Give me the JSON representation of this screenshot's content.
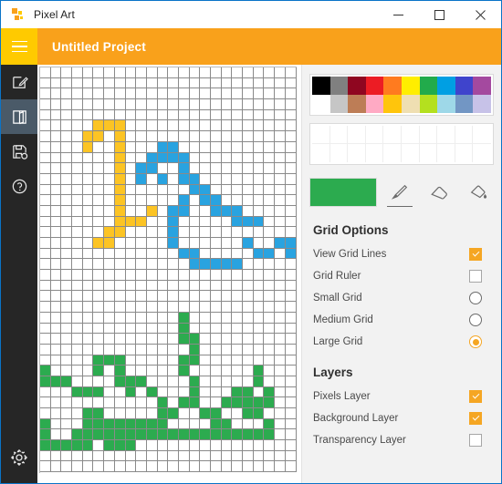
{
  "window": {
    "title": "Pixel Art",
    "app_icon": "pixel-art-icon",
    "minimize_label": "—",
    "maximize_label": "□",
    "close_label": "✕"
  },
  "header": {
    "menu_icon": "hamburger-menu-icon",
    "project_title": "Untitled Project",
    "accent_color": "#f9a11b",
    "menu_bg_color": "#ffca00"
  },
  "rail": {
    "items": [
      {
        "name": "new-document",
        "icon": "pencil-square-icon",
        "active": false
      },
      {
        "name": "open-document",
        "icon": "open-folder-icon",
        "active": true
      },
      {
        "name": "save-document",
        "icon": "save-as-icon",
        "active": false
      },
      {
        "name": "help",
        "icon": "question-circle-icon",
        "active": false
      }
    ],
    "settings": {
      "name": "settings",
      "icon": "gear-icon"
    },
    "background_color": "#262626",
    "active_color": "#4a5a68"
  },
  "palette": {
    "row1": [
      "#000000",
      "#808080",
      "#8f0620",
      "#ec1c24",
      "#ff7b1f",
      "#ffee00",
      "#22ab4b",
      "#009fe3",
      "#3f44cc",
      "#a4499f"
    ],
    "row2": [
      "#ffffff",
      "#c6c6c6",
      "#bd7d56",
      "#ffaac4",
      "#ffc50c",
      "#efdfb2",
      "#b4e01f",
      "#9ed8e8",
      "#7296c4",
      "#c7c2e8"
    ],
    "empty_rows": 2,
    "empty_cols": 10
  },
  "tools": {
    "current_color": "#2cab4f",
    "items": [
      {
        "name": "pencil-tool",
        "icon": "pencil-icon",
        "active": true
      },
      {
        "name": "eraser-tool",
        "icon": "eraser-icon",
        "active": false
      },
      {
        "name": "fill-tool",
        "icon": "paint-bucket-icon",
        "active": false
      }
    ]
  },
  "grid_options": {
    "title": "Grid Options",
    "checks": [
      {
        "label": "View Grid Lines",
        "checked": true,
        "name": "view-grid-lines"
      },
      {
        "label": "Grid Ruler",
        "checked": false,
        "name": "grid-ruler"
      }
    ],
    "radios": [
      {
        "label": "Small Grid",
        "selected": false,
        "name": "small-grid"
      },
      {
        "label": "Medium Grid",
        "selected": false,
        "name": "medium-grid"
      },
      {
        "label": "Large Grid",
        "selected": true,
        "name": "large-grid"
      }
    ]
  },
  "layers": {
    "title": "Layers",
    "items": [
      {
        "label": "Pixels Layer",
        "checked": true,
        "name": "pixels-layer"
      },
      {
        "label": "Background Layer",
        "checked": true,
        "name": "background-layer"
      },
      {
        "label": "Transparency Layer",
        "checked": false,
        "name": "transparency-layer"
      }
    ]
  },
  "canvas": {
    "cols": 24,
    "rows": 38,
    "cell_size": 11.7,
    "colors": {
      "y": "#fcc424",
      "b": "#29a3e0",
      "g": "#2cab4f"
    },
    "pixels": [
      {
        "r": 5,
        "c": 5,
        "k": "y"
      },
      {
        "r": 5,
        "c": 6,
        "k": "y"
      },
      {
        "r": 5,
        "c": 7,
        "k": "y"
      },
      {
        "r": 6,
        "c": 4,
        "k": "y"
      },
      {
        "r": 6,
        "c": 5,
        "k": "y"
      },
      {
        "r": 6,
        "c": 7,
        "k": "y"
      },
      {
        "r": 7,
        "c": 4,
        "k": "y"
      },
      {
        "r": 7,
        "c": 7,
        "k": "y"
      },
      {
        "r": 8,
        "c": 7,
        "k": "y"
      },
      {
        "r": 9,
        "c": 7,
        "k": "y"
      },
      {
        "r": 10,
        "c": 7,
        "k": "y"
      },
      {
        "r": 11,
        "c": 7,
        "k": "y"
      },
      {
        "r": 12,
        "c": 7,
        "k": "y"
      },
      {
        "r": 13,
        "c": 7,
        "k": "y"
      },
      {
        "r": 13,
        "c": 10,
        "k": "y"
      },
      {
        "r": 14,
        "c": 7,
        "k": "y"
      },
      {
        "r": 14,
        "c": 8,
        "k": "y"
      },
      {
        "r": 14,
        "c": 9,
        "k": "y"
      },
      {
        "r": 15,
        "c": 6,
        "k": "y"
      },
      {
        "r": 15,
        "c": 7,
        "k": "y"
      },
      {
        "r": 16,
        "c": 5,
        "k": "y"
      },
      {
        "r": 16,
        "c": 6,
        "k": "y"
      },
      {
        "r": 7,
        "c": 11,
        "k": "b"
      },
      {
        "r": 7,
        "c": 12,
        "k": "b"
      },
      {
        "r": 8,
        "c": 10,
        "k": "b"
      },
      {
        "r": 8,
        "c": 11,
        "k": "b"
      },
      {
        "r": 8,
        "c": 12,
        "k": "b"
      },
      {
        "r": 8,
        "c": 13,
        "k": "b"
      },
      {
        "r": 9,
        "c": 9,
        "k": "b"
      },
      {
        "r": 9,
        "c": 10,
        "k": "b"
      },
      {
        "r": 9,
        "c": 13,
        "k": "b"
      },
      {
        "r": 10,
        "c": 9,
        "k": "b"
      },
      {
        "r": 10,
        "c": 11,
        "k": "b"
      },
      {
        "r": 10,
        "c": 13,
        "k": "b"
      },
      {
        "r": 10,
        "c": 14,
        "k": "b"
      },
      {
        "r": 11,
        "c": 14,
        "k": "b"
      },
      {
        "r": 11,
        "c": 15,
        "k": "b"
      },
      {
        "r": 12,
        "c": 13,
        "k": "b"
      },
      {
        "r": 12,
        "c": 15,
        "k": "b"
      },
      {
        "r": 12,
        "c": 16,
        "k": "b"
      },
      {
        "r": 13,
        "c": 12,
        "k": "b"
      },
      {
        "r": 13,
        "c": 13,
        "k": "b"
      },
      {
        "r": 13,
        "c": 16,
        "k": "b"
      },
      {
        "r": 13,
        "c": 17,
        "k": "b"
      },
      {
        "r": 13,
        "c": 18,
        "k": "b"
      },
      {
        "r": 14,
        "c": 12,
        "k": "b"
      },
      {
        "r": 14,
        "c": 18,
        "k": "b"
      },
      {
        "r": 14,
        "c": 19,
        "k": "b"
      },
      {
        "r": 14,
        "c": 20,
        "k": "b"
      },
      {
        "r": 15,
        "c": 12,
        "k": "b"
      },
      {
        "r": 16,
        "c": 12,
        "k": "b"
      },
      {
        "r": 16,
        "c": 19,
        "k": "b"
      },
      {
        "r": 16,
        "c": 22,
        "k": "b"
      },
      {
        "r": 16,
        "c": 23,
        "k": "b"
      },
      {
        "r": 17,
        "c": 13,
        "k": "b"
      },
      {
        "r": 17,
        "c": 14,
        "k": "b"
      },
      {
        "r": 17,
        "c": 20,
        "k": "b"
      },
      {
        "r": 17,
        "c": 21,
        "k": "b"
      },
      {
        "r": 17,
        "c": 23,
        "k": "b"
      },
      {
        "r": 18,
        "c": 14,
        "k": "b"
      },
      {
        "r": 18,
        "c": 15,
        "k": "b"
      },
      {
        "r": 18,
        "c": 16,
        "k": "b"
      },
      {
        "r": 18,
        "c": 17,
        "k": "b"
      },
      {
        "r": 18,
        "c": 18,
        "k": "b"
      },
      {
        "r": 23,
        "c": 13,
        "k": "g"
      },
      {
        "r": 24,
        "c": 13,
        "k": "g"
      },
      {
        "r": 25,
        "c": 13,
        "k": "g"
      },
      {
        "r": 25,
        "c": 14,
        "k": "g"
      },
      {
        "r": 26,
        "c": 14,
        "k": "g"
      },
      {
        "r": 27,
        "c": 13,
        "k": "g"
      },
      {
        "r": 27,
        "c": 14,
        "k": "g"
      },
      {
        "r": 27,
        "c": 5,
        "k": "g"
      },
      {
        "r": 27,
        "c": 6,
        "k": "g"
      },
      {
        "r": 27,
        "c": 7,
        "k": "g"
      },
      {
        "r": 28,
        "c": 0,
        "k": "g"
      },
      {
        "r": 28,
        "c": 5,
        "k": "g"
      },
      {
        "r": 28,
        "c": 7,
        "k": "g"
      },
      {
        "r": 28,
        "c": 13,
        "k": "g"
      },
      {
        "r": 28,
        "c": 20,
        "k": "g"
      },
      {
        "r": 29,
        "c": 0,
        "k": "g"
      },
      {
        "r": 29,
        "c": 1,
        "k": "g"
      },
      {
        "r": 29,
        "c": 2,
        "k": "g"
      },
      {
        "r": 29,
        "c": 7,
        "k": "g"
      },
      {
        "r": 29,
        "c": 8,
        "k": "g"
      },
      {
        "r": 29,
        "c": 9,
        "k": "g"
      },
      {
        "r": 29,
        "c": 14,
        "k": "g"
      },
      {
        "r": 29,
        "c": 20,
        "k": "g"
      },
      {
        "r": 30,
        "c": 3,
        "k": "g"
      },
      {
        "r": 30,
        "c": 4,
        "k": "g"
      },
      {
        "r": 30,
        "c": 5,
        "k": "g"
      },
      {
        "r": 30,
        "c": 8,
        "k": "g"
      },
      {
        "r": 30,
        "c": 10,
        "k": "g"
      },
      {
        "r": 30,
        "c": 14,
        "k": "g"
      },
      {
        "r": 30,
        "c": 18,
        "k": "g"
      },
      {
        "r": 30,
        "c": 19,
        "k": "g"
      },
      {
        "r": 30,
        "c": 21,
        "k": "g"
      },
      {
        "r": 31,
        "c": 11,
        "k": "g"
      },
      {
        "r": 31,
        "c": 13,
        "k": "g"
      },
      {
        "r": 31,
        "c": 14,
        "k": "g"
      },
      {
        "r": 31,
        "c": 17,
        "k": "g"
      },
      {
        "r": 31,
        "c": 18,
        "k": "g"
      },
      {
        "r": 31,
        "c": 19,
        "k": "g"
      },
      {
        "r": 31,
        "c": 20,
        "k": "g"
      },
      {
        "r": 31,
        "c": 21,
        "k": "g"
      },
      {
        "r": 32,
        "c": 4,
        "k": "g"
      },
      {
        "r": 32,
        "c": 5,
        "k": "g"
      },
      {
        "r": 32,
        "c": 11,
        "k": "g"
      },
      {
        "r": 32,
        "c": 12,
        "k": "g"
      },
      {
        "r": 32,
        "c": 15,
        "k": "g"
      },
      {
        "r": 32,
        "c": 16,
        "k": "g"
      },
      {
        "r": 32,
        "c": 19,
        "k": "g"
      },
      {
        "r": 32,
        "c": 20,
        "k": "g"
      },
      {
        "r": 33,
        "c": 0,
        "k": "g"
      },
      {
        "r": 33,
        "c": 4,
        "k": "g"
      },
      {
        "r": 33,
        "c": 5,
        "k": "g"
      },
      {
        "r": 33,
        "c": 6,
        "k": "g"
      },
      {
        "r": 33,
        "c": 7,
        "k": "g"
      },
      {
        "r": 33,
        "c": 8,
        "k": "g"
      },
      {
        "r": 33,
        "c": 9,
        "k": "g"
      },
      {
        "r": 33,
        "c": 10,
        "k": "g"
      },
      {
        "r": 33,
        "c": 11,
        "k": "g"
      },
      {
        "r": 33,
        "c": 16,
        "k": "g"
      },
      {
        "r": 33,
        "c": 17,
        "k": "g"
      },
      {
        "r": 33,
        "c": 21,
        "k": "g"
      },
      {
        "r": 34,
        "c": 0,
        "k": "g"
      },
      {
        "r": 34,
        "c": 3,
        "k": "g"
      },
      {
        "r": 34,
        "c": 4,
        "k": "g"
      },
      {
        "r": 34,
        "c": 5,
        "k": "g"
      },
      {
        "r": 34,
        "c": 6,
        "k": "g"
      },
      {
        "r": 34,
        "c": 7,
        "k": "g"
      },
      {
        "r": 34,
        "c": 8,
        "k": "g"
      },
      {
        "r": 34,
        "c": 9,
        "k": "g"
      },
      {
        "r": 34,
        "c": 10,
        "k": "g"
      },
      {
        "r": 34,
        "c": 11,
        "k": "g"
      },
      {
        "r": 34,
        "c": 12,
        "k": "g"
      },
      {
        "r": 34,
        "c": 13,
        "k": "g"
      },
      {
        "r": 34,
        "c": 14,
        "k": "g"
      },
      {
        "r": 34,
        "c": 15,
        "k": "g"
      },
      {
        "r": 34,
        "c": 16,
        "k": "g"
      },
      {
        "r": 34,
        "c": 17,
        "k": "g"
      },
      {
        "r": 34,
        "c": 18,
        "k": "g"
      },
      {
        "r": 34,
        "c": 19,
        "k": "g"
      },
      {
        "r": 34,
        "c": 20,
        "k": "g"
      },
      {
        "r": 34,
        "c": 21,
        "k": "g"
      },
      {
        "r": 35,
        "c": 0,
        "k": "g"
      },
      {
        "r": 35,
        "c": 1,
        "k": "g"
      },
      {
        "r": 35,
        "c": 2,
        "k": "g"
      },
      {
        "r": 35,
        "c": 3,
        "k": "g"
      },
      {
        "r": 35,
        "c": 4,
        "k": "g"
      },
      {
        "r": 35,
        "c": 6,
        "k": "g"
      },
      {
        "r": 35,
        "c": 7,
        "k": "g"
      },
      {
        "r": 35,
        "c": 8,
        "k": "g"
      }
    ]
  }
}
